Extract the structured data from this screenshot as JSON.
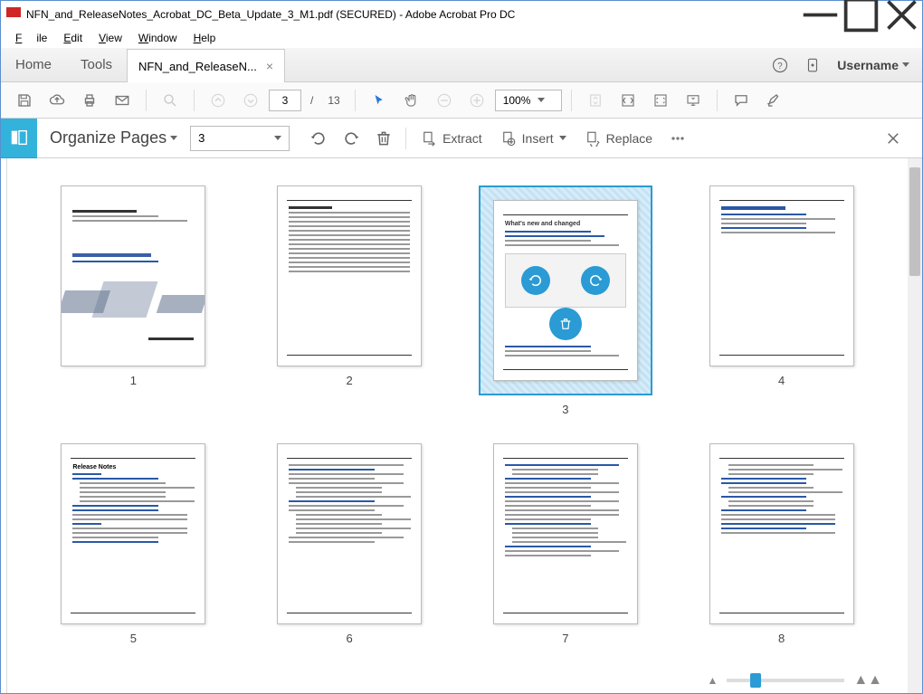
{
  "window": {
    "title": "NFN_and_ReleaseNotes_Acrobat_DC_Beta_Update_3_M1.pdf (SECURED) - Adobe Acrobat Pro DC"
  },
  "menu": {
    "file": "File",
    "edit": "Edit",
    "view": "View",
    "window": "Window",
    "help": "Help"
  },
  "tabs": {
    "home": "Home",
    "tools": "Tools",
    "active": "NFN_and_ReleaseN..."
  },
  "user": {
    "label": "Username"
  },
  "toolbar": {
    "page_current": "3",
    "page_sep": "/",
    "page_total": "13",
    "zoom": "100%"
  },
  "organize": {
    "title": "Organize Pages",
    "select_value": "3",
    "extract": "Extract",
    "insert": "Insert",
    "replace": "Replace"
  },
  "thumbs": {
    "labels": [
      "1",
      "2",
      "3",
      "4",
      "5",
      "6",
      "7",
      "8"
    ],
    "selected_index": 2,
    "page3_heading": "What's new and changed",
    "page5_heading": "Release Notes"
  }
}
